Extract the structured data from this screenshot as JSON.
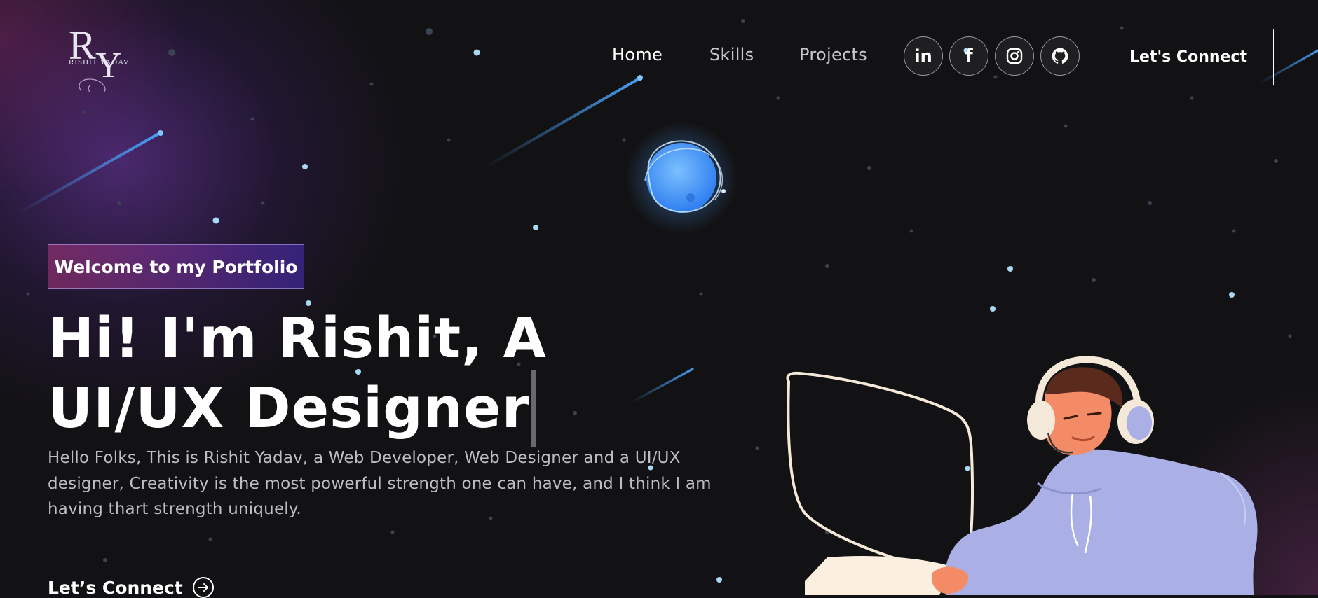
{
  "logo": {
    "monogram": "RY",
    "name": "RISHIT YADAV"
  },
  "nav": {
    "items": [
      {
        "label": "Home",
        "active": true
      },
      {
        "label": "Skills",
        "active": false
      },
      {
        "label": "Projects",
        "active": false
      }
    ]
  },
  "social": [
    {
      "icon": "linkedin-icon",
      "glyph": "in"
    },
    {
      "icon": "facebook-icon",
      "glyph": "f"
    },
    {
      "icon": "instagram-icon"
    },
    {
      "icon": "github-icon"
    }
  ],
  "header": {
    "connect_label": "Let's Connect"
  },
  "hero": {
    "tagline": "Welcome to my Portfolio",
    "headline": "Hi! I'm Rishit, A UI/UX Designer",
    "intro": "Hello Folks, This is Rishit Yadav, a Web Developer, Web Designer and a UI/UX designer, Creativity is the most powerful strength one can have, and I think I am having thart strength uniquely.",
    "cta_label": "Let’s Connect"
  },
  "colors": {
    "background": "#121214",
    "tagline_gradient_start": "#aa367c",
    "tagline_gradient_end": "#4a2fbd",
    "planet": "#4a9dff",
    "hoodie": "#aab0e6",
    "star": "#a9d8f5"
  }
}
